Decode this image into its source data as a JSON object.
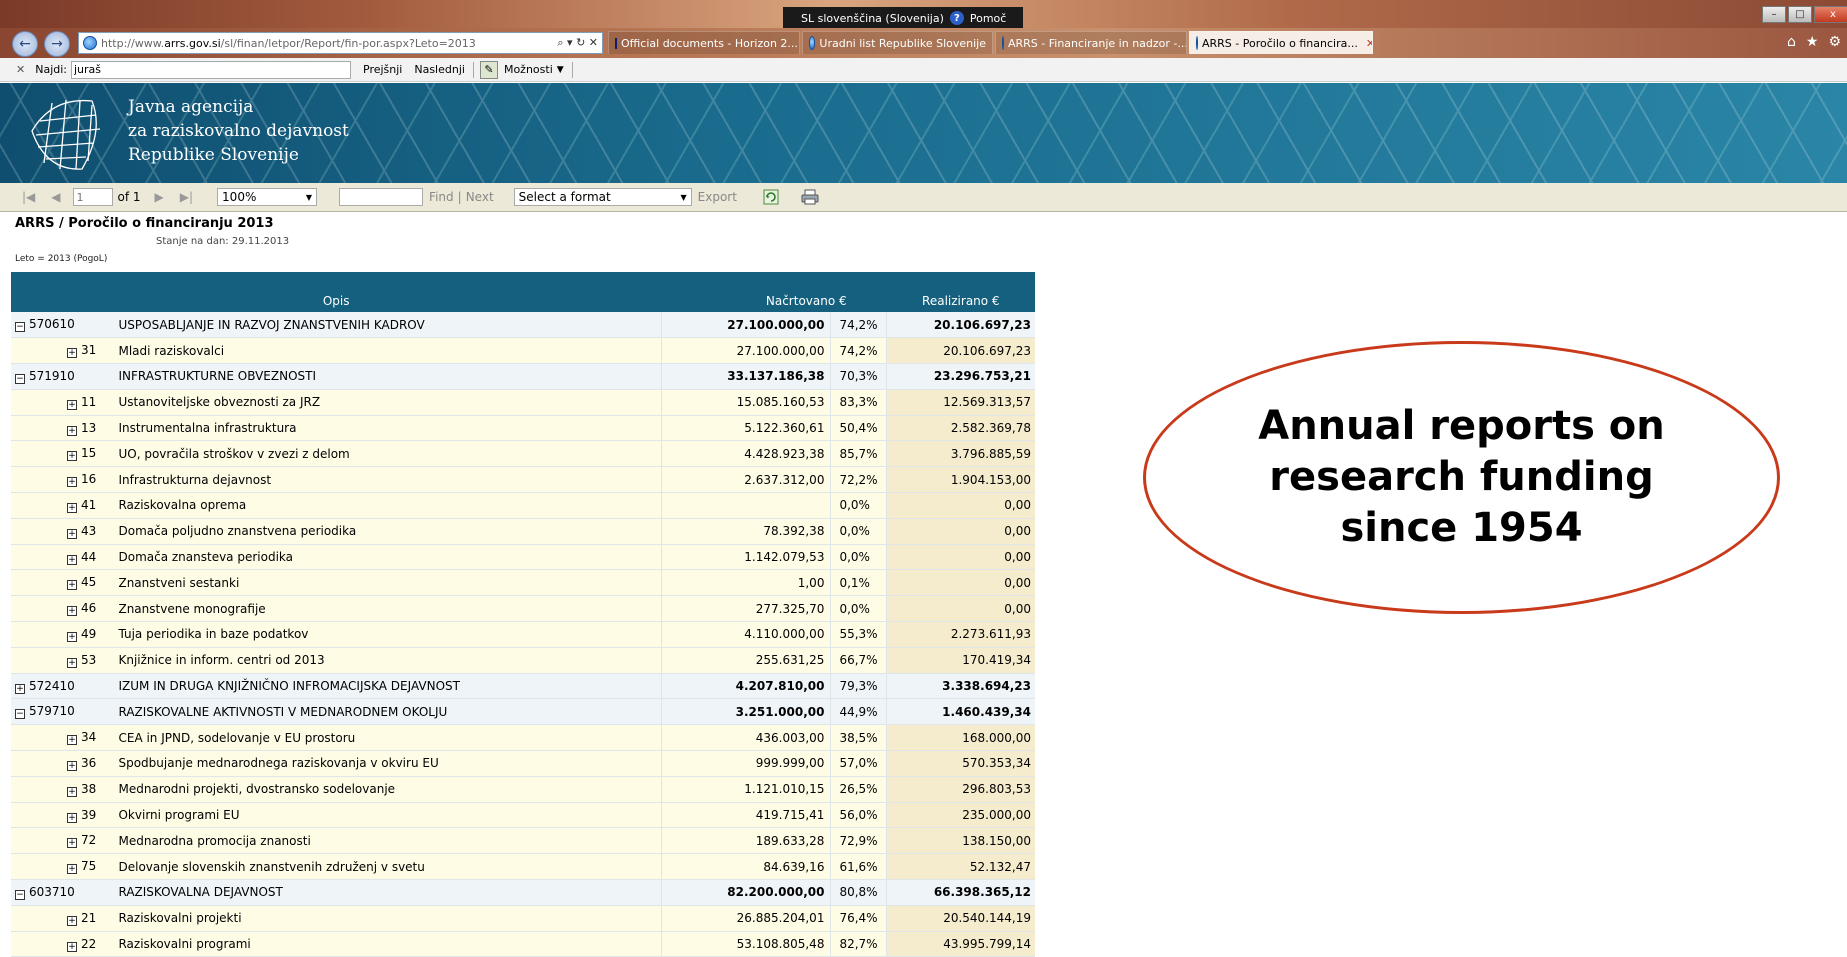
{
  "browser": {
    "language_bar": "SL slovenščina (Slovenija)",
    "help_label": "Pomoč",
    "address": {
      "prefix": "http://www.",
      "domain": "arrs.gov.si",
      "path": "/sl/finan/letpor/Report/fin-por.aspx?Leto=2013"
    },
    "tabs": [
      {
        "label": "Official documents - Horizon 2...",
        "icon": "eu-flag-icon",
        "active": false
      },
      {
        "label": "Uradni list Republike Slovenije",
        "icon": "ie-icon",
        "active": false
      },
      {
        "label": "ARRS - Financiranje in nadzor -...",
        "icon": "ie-icon",
        "active": false
      },
      {
        "label": "ARRS - Poročilo o financira...",
        "icon": "ie-icon",
        "active": true
      }
    ],
    "find": {
      "label": "Najdi:",
      "value": "juraš",
      "prev": "Prejšnji",
      "next": "Naslednji",
      "options": "Možnosti"
    }
  },
  "site": {
    "title_line1": "Javna agencija",
    "title_line2": "za raziskovalno dejavnost",
    "title_line3": "Republike Slovenije"
  },
  "toolbar": {
    "page_value": "1",
    "page_of": "of 1",
    "zoom": "100%",
    "find_label": "Find",
    "sep": "|",
    "next_label": "Next",
    "format_label": "Select a format",
    "export_label": "Export"
  },
  "report": {
    "title": "ARRS / Poročilo o financiranju 2013",
    "date": "Stanje na dan: 29.11.2013",
    "param": "Leto = 2013 (PogoL)",
    "headers": {
      "opis": "Opis",
      "plan": "Načrtovano €",
      "real": "Realizirano €"
    },
    "rows": [
      {
        "type": "grp",
        "sign": "−",
        "code": "570610",
        "desc": "USPOSABLJANJE IN RAZVOJ ZNANSTVENIH KADROV",
        "plan": "27.100.000,00",
        "pct": "74,2%",
        "real": "20.106.697,23"
      },
      {
        "type": "sub",
        "sign": "+",
        "code": "31",
        "desc": "Mladi raziskovalci",
        "plan": "27.100.000,00",
        "pct": "74,2%",
        "real": "20.106.697,23"
      },
      {
        "type": "grp",
        "sign": "−",
        "code": "571910",
        "desc": "INFRASTRUKTURNE OBVEZNOSTI",
        "plan": "33.137.186,38",
        "pct": "70,3%",
        "real": "23.296.753,21"
      },
      {
        "type": "sub",
        "sign": "+",
        "code": "11",
        "desc": "Ustanoviteljske obveznosti za JRZ",
        "plan": "15.085.160,53",
        "pct": "83,3%",
        "real": "12.569.313,57"
      },
      {
        "type": "sub",
        "sign": "+",
        "code": "13",
        "desc": "Instrumentalna infrastruktura",
        "plan": "5.122.360,61",
        "pct": "50,4%",
        "real": "2.582.369,78"
      },
      {
        "type": "sub",
        "sign": "+",
        "code": "15",
        "desc": "UO, povračila stroškov v zvezi z delom",
        "plan": "4.428.923,38",
        "pct": "85,7%",
        "real": "3.796.885,59"
      },
      {
        "type": "sub",
        "sign": "+",
        "code": "16",
        "desc": "Infrastrukturna dejavnost",
        "plan": "2.637.312,00",
        "pct": "72,2%",
        "real": "1.904.153,00"
      },
      {
        "type": "sub",
        "sign": "+",
        "code": "41",
        "desc": "Raziskovalna oprema",
        "plan": "",
        "pct": "0,0%",
        "real": "0,00"
      },
      {
        "type": "sub",
        "sign": "+",
        "code": "43",
        "desc": "Domača poljudno znanstvena periodika",
        "plan": "78.392,38",
        "pct": "0,0%",
        "real": "0,00"
      },
      {
        "type": "sub",
        "sign": "+",
        "code": "44",
        "desc": "Domača znansteva periodika",
        "plan": "1.142.079,53",
        "pct": "0,0%",
        "real": "0,00"
      },
      {
        "type": "sub",
        "sign": "+",
        "code": "45",
        "desc": "Znanstveni sestanki",
        "plan": "1,00",
        "pct": "0,1%",
        "real": "0,00"
      },
      {
        "type": "sub",
        "sign": "+",
        "code": "46",
        "desc": "Znanstvene monografije",
        "plan": "277.325,70",
        "pct": "0,0%",
        "real": "0,00"
      },
      {
        "type": "sub",
        "sign": "+",
        "code": "49",
        "desc": "Tuja periodika in baze podatkov",
        "plan": "4.110.000,00",
        "pct": "55,3%",
        "real": "2.273.611,93"
      },
      {
        "type": "sub",
        "sign": "+",
        "code": "53",
        "desc": "Knjižnice in inform. centri od 2013",
        "plan": "255.631,25",
        "pct": "66,7%",
        "real": "170.419,34"
      },
      {
        "type": "grp",
        "sign": "+",
        "code": "572410",
        "desc": "IZUM IN DRUGA KNJIŽNIČNO INFROMACIJSKA DEJAVNOST",
        "plan": "4.207.810,00",
        "pct": "79,3%",
        "real": "3.338.694,23"
      },
      {
        "type": "grp",
        "sign": "−",
        "code": "579710",
        "desc": "RAZISKOVALNE AKTIVNOSTI V MEDNARODNEM OKOLJU",
        "plan": "3.251.000,00",
        "pct": "44,9%",
        "real": "1.460.439,34"
      },
      {
        "type": "sub",
        "sign": "+",
        "code": "34",
        "desc": "CEA in JPND, sodelovanje v EU prostoru",
        "plan": "436.003,00",
        "pct": "38,5%",
        "real": "168.000,00"
      },
      {
        "type": "sub",
        "sign": "+",
        "code": "36",
        "desc": "Spodbujanje mednarodnega raziskovanja v okviru EU",
        "plan": "999.999,00",
        "pct": "57,0%",
        "real": "570.353,34"
      },
      {
        "type": "sub",
        "sign": "+",
        "code": "38",
        "desc": "Mednarodni projekti, dvostransko sodelovanje",
        "plan": "1.121.010,15",
        "pct": "26,5%",
        "real": "296.803,53"
      },
      {
        "type": "sub",
        "sign": "+",
        "code": "39",
        "desc": "Okvirni programi EU",
        "plan": "419.715,41",
        "pct": "56,0%",
        "real": "235.000,00"
      },
      {
        "type": "sub",
        "sign": "+",
        "code": "72",
        "desc": "Mednarodna promocija znanosti",
        "plan": "189.633,28",
        "pct": "72,9%",
        "real": "138.150,00"
      },
      {
        "type": "sub",
        "sign": "+",
        "code": "75",
        "desc": "Delovanje slovenskih znanstvenih združenj v svetu",
        "plan": "84.639,16",
        "pct": "61,6%",
        "real": "52.132,47"
      },
      {
        "type": "grp",
        "sign": "−",
        "code": "603710",
        "desc": "RAZISKOVALNA DEJAVNOST",
        "plan": "82.200.000,00",
        "pct": "80,8%",
        "real": "66.398.365,12"
      },
      {
        "type": "sub",
        "sign": "+",
        "code": "21",
        "desc": "Raziskovalni projekti",
        "plan": "26.885.204,01",
        "pct": "76,4%",
        "real": "20.540.144,19"
      },
      {
        "type": "sub",
        "sign": "+",
        "code": "22",
        "desc": "Raziskovalni programi",
        "plan": "53.108.805,48",
        "pct": "82,7%",
        "real": "43.995.799,14"
      }
    ]
  },
  "callout": {
    "text": "Annual reports on\nresearch funding\nsince 1954"
  },
  "colors": {
    "header_blue": "#15607f",
    "callout_border": "#c83a1a",
    "toolbar_bg": "#ece9d8"
  }
}
